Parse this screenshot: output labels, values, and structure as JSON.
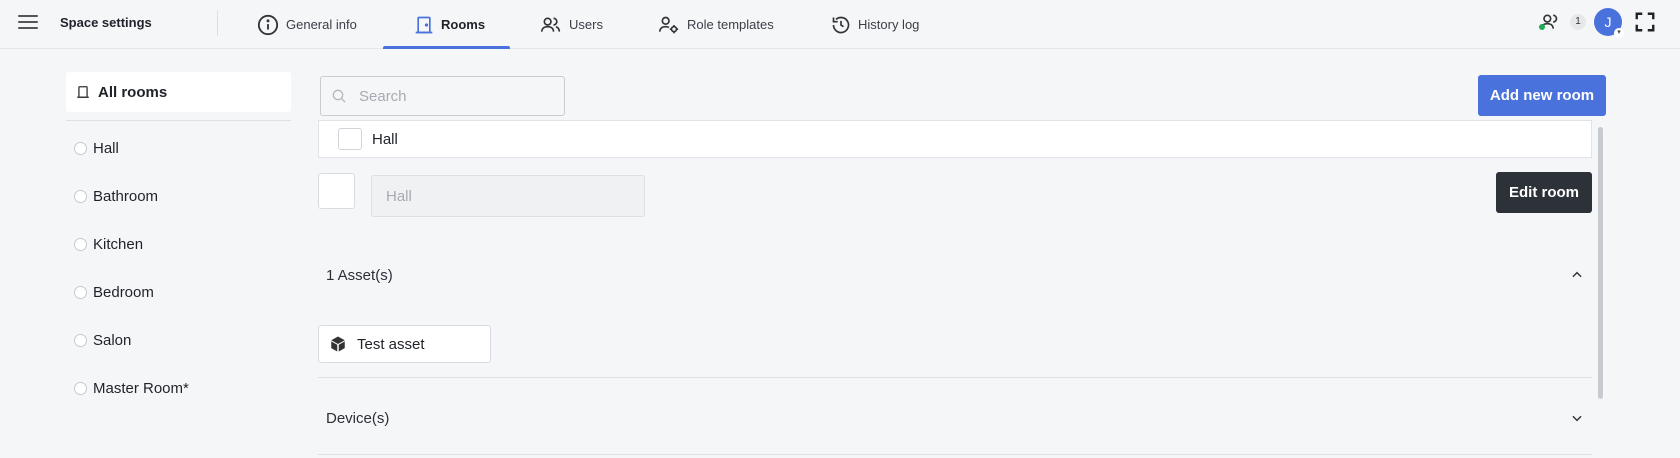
{
  "header": {
    "app_title": "Space settings",
    "tabs": [
      {
        "label": "General info",
        "icon": "info-icon"
      },
      {
        "label": "Rooms",
        "icon": "door-icon",
        "active": true
      },
      {
        "label": "Users",
        "icon": "users-icon"
      },
      {
        "label": "Role templates",
        "icon": "user-gear-icon"
      },
      {
        "label": "History log",
        "icon": "history-icon"
      }
    ],
    "online_count": "1",
    "avatar_initial": "J"
  },
  "sidebar": {
    "header_label": "All rooms",
    "rooms": [
      {
        "label": "Hall"
      },
      {
        "label": "Bathroom"
      },
      {
        "label": "Kitchen"
      },
      {
        "label": "Bedroom"
      },
      {
        "label": "Salon"
      },
      {
        "label": "Master Room*"
      }
    ]
  },
  "main": {
    "search": {
      "placeholder": "Search",
      "value": ""
    },
    "add_button_label": "Add new room",
    "selected_room": {
      "label": "Hall"
    },
    "edit": {
      "name_placeholder": "Hall",
      "name_value": "",
      "edit_button_label": "Edit room"
    },
    "sections": [
      {
        "label": "1 Asset(s)",
        "expanded": true,
        "items": [
          {
            "label": "Test asset",
            "icon": "cube-icon"
          }
        ]
      },
      {
        "label": "Device(s)",
        "expanded": false
      }
    ]
  },
  "colors": {
    "accent": "#4a72dc",
    "dark_button": "#2d3238",
    "online": "#1faa59",
    "background": "#f5f6f8"
  }
}
